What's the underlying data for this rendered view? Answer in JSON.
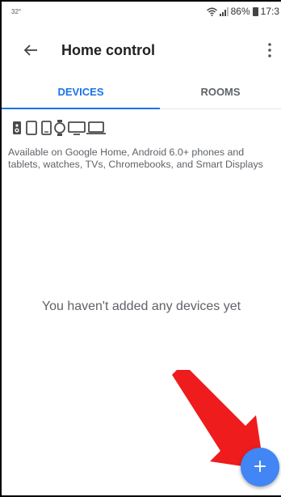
{
  "status_bar": {
    "temperature": "32°",
    "battery_level": "86%",
    "time": "17:3",
    "icons": [
      "wifi-icon",
      "signal-icon",
      "battery-icon"
    ]
  },
  "app_bar": {
    "title": "Home control",
    "back_icon": "arrow-left-icon",
    "menu_icon": "more-vert-icon"
  },
  "tabs": [
    {
      "label": "DEVICES",
      "active": true
    },
    {
      "label": "ROOMS",
      "active": false
    }
  ],
  "device_types": [
    "speaker-icon",
    "tablet-icon",
    "phone-icon",
    "watch-icon",
    "tv-icon",
    "laptop-icon"
  ],
  "availability_text": "Available on Google Home, Android 6.0+ phones and tablets, watches, TVs, Chromebooks, and Smart Displays",
  "empty_state": "You haven't added any devices yet",
  "fab": {
    "icon": "plus-icon",
    "label": "+"
  },
  "colors": {
    "accent": "#1a73e8",
    "fab": "#4285f4",
    "arrow": "#ee1c1c"
  }
}
